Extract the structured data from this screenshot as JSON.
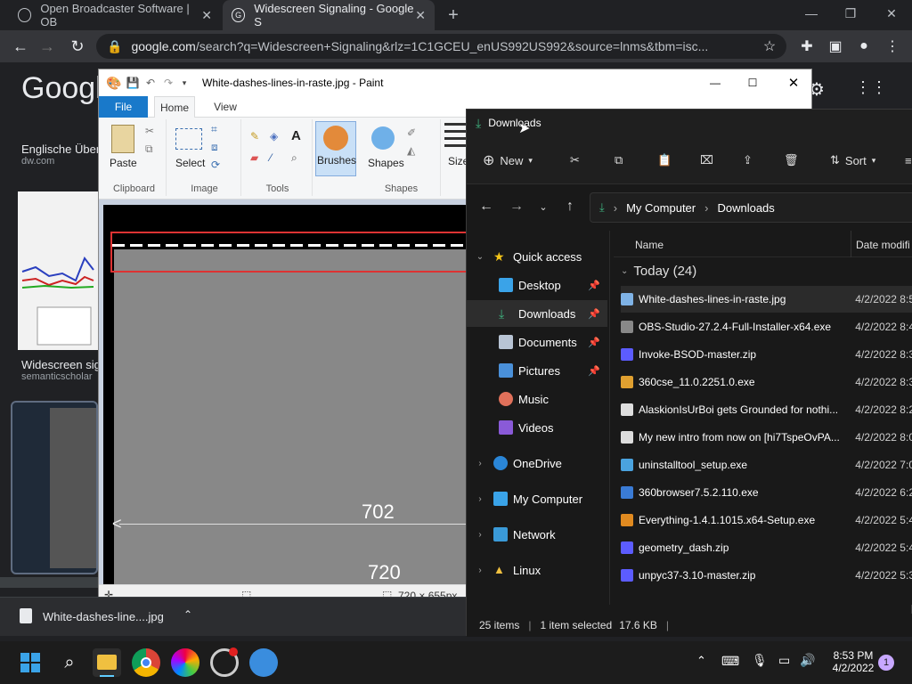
{
  "browser": {
    "tabs": [
      {
        "title": "Open Broadcaster Software | OB",
        "active": false
      },
      {
        "title": "Widescreen Signaling - Google S",
        "active": true
      }
    ],
    "url_host": "google.com",
    "url_rest": "/search?q=Widescreen+Signaling&rlz=1C1GCEU_enUS992US992&source=lnms&tbm=isc...",
    "download": {
      "filename": "White-dashes-line....jpg"
    }
  },
  "google": {
    "logo": "Google",
    "results": [
      {
        "title": "Englische Übers",
        "source": "dw.com"
      },
      {
        "title": "Widescreen sig",
        "source": "semanticscholar"
      }
    ]
  },
  "paint": {
    "title": "White-dashes-lines-in-raste.jpg - Paint",
    "tabs": {
      "file": "File",
      "home": "Home",
      "view": "View"
    },
    "groups": {
      "clipboard": "Clipboard",
      "image": "Image",
      "tools": "Tools",
      "shapes": "Shapes"
    },
    "buttons": {
      "paste": "Paste",
      "select": "Select",
      "brushes": "Brushes",
      "shapes": "Shapes",
      "size": "Size"
    },
    "canvas_labels": {
      "top": "702",
      "bottom": "720"
    },
    "status": {
      "dimensions": "720 × 655px"
    }
  },
  "explorer": {
    "title": "Downloads",
    "commands": {
      "new": "New",
      "sort": "Sort"
    },
    "address": {
      "root": "My Computer",
      "folder": "Downloads"
    },
    "nav": [
      {
        "label": "Quick access",
        "type": "section"
      },
      {
        "label": "Desktop",
        "pinned": true
      },
      {
        "label": "Downloads",
        "pinned": true,
        "selected": true
      },
      {
        "label": "Documents",
        "pinned": true
      },
      {
        "label": "Pictures",
        "pinned": true
      },
      {
        "label": "Music",
        "pinned": false
      },
      {
        "label": "Videos",
        "pinned": false
      },
      {
        "label": "OneDrive",
        "type": "section"
      },
      {
        "label": "My Computer",
        "type": "section"
      },
      {
        "label": "Network",
        "type": "section"
      },
      {
        "label": "Linux",
        "type": "section"
      }
    ],
    "columns": {
      "name": "Name",
      "date": "Date modifi"
    },
    "group": "Today (24)",
    "files": [
      {
        "name": "White-dashes-lines-in-raste.jpg",
        "date": "4/2/2022 8:5",
        "color": "#7fb3e6"
      },
      {
        "name": "OBS-Studio-27.2.4-Full-Installer-x64.exe",
        "date": "4/2/2022 8:4",
        "color": "#888888"
      },
      {
        "name": "Invoke-BSOD-master.zip",
        "date": "4/2/2022 8:3",
        "color": "#5c5cff"
      },
      {
        "name": "360cse_11.0.2251.0.exe",
        "date": "4/2/2022 8:3",
        "color": "#e0a030"
      },
      {
        "name": "AlaskionIsUrBoi gets Grounded for nothi...",
        "date": "4/2/2022 8:2",
        "color": "#dddddd"
      },
      {
        "name": "My new intro from now on [hi7TspeOvPA...",
        "date": "4/2/2022 8:0",
        "color": "#dddddd"
      },
      {
        "name": "uninstalltool_setup.exe",
        "date": "4/2/2022 7:0",
        "color": "#4aa3df"
      },
      {
        "name": "360browser7.5.2.110.exe",
        "date": "4/2/2022 6:2",
        "color": "#3a7bd5"
      },
      {
        "name": "Everything-1.4.1.1015.x64-Setup.exe",
        "date": "4/2/2022 5:4",
        "color": "#e08a20"
      },
      {
        "name": "geometry_dash.zip",
        "date": "4/2/2022 5:4",
        "color": "#5c5cff"
      },
      {
        "name": "unpyc37-3.10-master.zip",
        "date": "4/2/2022 5:3",
        "color": "#5c5cff"
      }
    ],
    "status": {
      "count": "25 items",
      "selected": "1 item selected",
      "size": "17.6 KB"
    }
  },
  "taskbar": {
    "time": "8:53 PM",
    "date": "4/2/2022",
    "notifications": "1"
  }
}
